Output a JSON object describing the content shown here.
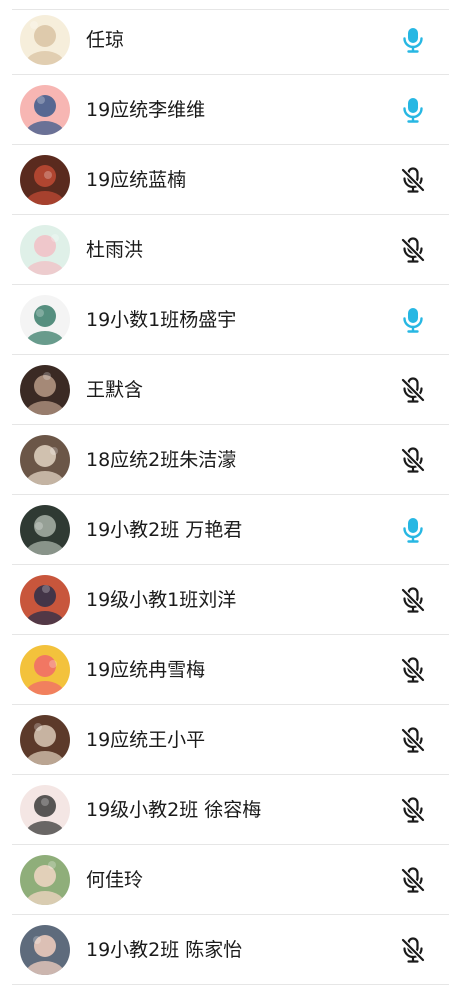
{
  "colors": {
    "mic_on": "#27b7e3",
    "mic_off": "#1a1a1a",
    "divider": "#e6e6e6"
  },
  "members": [
    {
      "name": "任琼",
      "mic": "on",
      "avatar_icon": "sheep-cartoon-avatar",
      "avatar_colors": [
        "#f6eedb",
        "#d9c3a3"
      ]
    },
    {
      "name": "19应统李维维",
      "mic": "on",
      "avatar_icon": "cartoon-character-avatar",
      "avatar_colors": [
        "#f7b6b3",
        "#3b5a8c"
      ]
    },
    {
      "name": "19应统蓝楠",
      "mic": "off",
      "avatar_icon": "photo-avatar",
      "avatar_colors": [
        "#5a2a1e",
        "#c04a34"
      ]
    },
    {
      "name": "杜雨洪",
      "mic": "off",
      "avatar_icon": "pig-cartoon-avatar",
      "avatar_colors": [
        "#dff0e8",
        "#f2c0c6"
      ]
    },
    {
      "name": "19小数1班杨盛宇",
      "mic": "on",
      "avatar_icon": "boy-cartoon-avatar",
      "avatar_colors": [
        "#f4f4f4",
        "#3a7d6a"
      ]
    },
    {
      "name": "王默含",
      "mic": "off",
      "avatar_icon": "photo-avatar",
      "avatar_colors": [
        "#3b2a24",
        "#b89a86"
      ]
    },
    {
      "name": "18应统2班朱洁濛",
      "mic": "off",
      "avatar_icon": "dog-photo-avatar",
      "avatar_colors": [
        "#6b5647",
        "#e2d4c2"
      ]
    },
    {
      "name": "19小教2班 万艳君",
      "mic": "on",
      "avatar_icon": "photo-avatar",
      "avatar_colors": [
        "#2f3a33",
        "#a8b3a8"
      ]
    },
    {
      "name": "19级小教1班刘洋",
      "mic": "off",
      "avatar_icon": "photo-avatar",
      "avatar_colors": [
        "#c8563c",
        "#2b2f4a"
      ]
    },
    {
      "name": "19应统冉雪梅",
      "mic": "off",
      "avatar_icon": "girl-cartoon-avatar",
      "avatar_colors": [
        "#f3c23c",
        "#f06a6a"
      ]
    },
    {
      "name": "19应统王小平",
      "mic": "off",
      "avatar_icon": "photo-avatar",
      "avatar_colors": [
        "#5c3a2a",
        "#d9c9b6"
      ]
    },
    {
      "name": "19级小教2班 徐容梅",
      "mic": "off",
      "avatar_icon": "girl-cartoon-avatar",
      "avatar_colors": [
        "#f4e6e4",
        "#3b3b3b"
      ]
    },
    {
      "name": "何佳玲",
      "mic": "off",
      "avatar_icon": "baby-photo-avatar",
      "avatar_colors": [
        "#8fae7a",
        "#f1d6c4"
      ]
    },
    {
      "name": "19小教2班 陈家怡",
      "mic": "off",
      "avatar_icon": "baby-photo-avatar",
      "avatar_colors": [
        "#5e6b7c",
        "#f2cfc0"
      ]
    }
  ]
}
